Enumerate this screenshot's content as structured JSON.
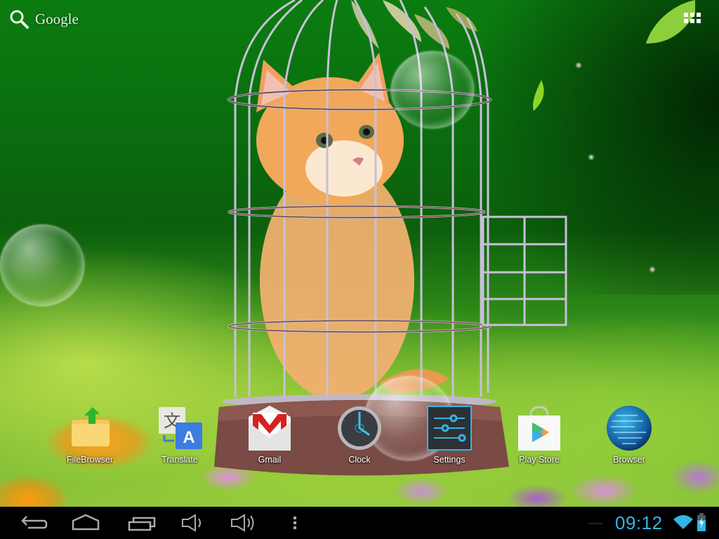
{
  "search_bar": {
    "label": "Google",
    "icon": "search-icon"
  },
  "apps_button": {
    "icon": "all-apps-grid-icon"
  },
  "wallpaper": {
    "description": "Live wallpaper: ginger kitten in a birdcage with floating bubbles"
  },
  "dock": {
    "apps": [
      {
        "label": "FileBrowser",
        "icon": "file-browser-icon"
      },
      {
        "label": "Translate",
        "icon": "translate-icon"
      },
      {
        "label": "Gmail",
        "icon": "gmail-icon"
      },
      {
        "label": "Clock",
        "icon": "clock-icon"
      },
      {
        "label": "Settings",
        "icon": "settings-icon"
      },
      {
        "label": "Play Store",
        "icon": "play-store-icon"
      },
      {
        "label": "Browser",
        "icon": "browser-icon"
      }
    ]
  },
  "navigation_bar": {
    "buttons": [
      {
        "name": "back",
        "icon": "back-icon"
      },
      {
        "name": "home",
        "icon": "home-icon"
      },
      {
        "name": "recent-apps",
        "icon": "recent-apps-icon"
      },
      {
        "name": "volume-down",
        "icon": "volume-down-icon"
      },
      {
        "name": "volume-up",
        "icon": "volume-up-icon"
      },
      {
        "name": "menu",
        "icon": "overflow-menu-icon"
      }
    ]
  },
  "status": {
    "time": "09:12",
    "wifi_icon": "wifi-icon",
    "battery_icon": "battery-charging-icon",
    "accent_color": "#33b5e5"
  }
}
